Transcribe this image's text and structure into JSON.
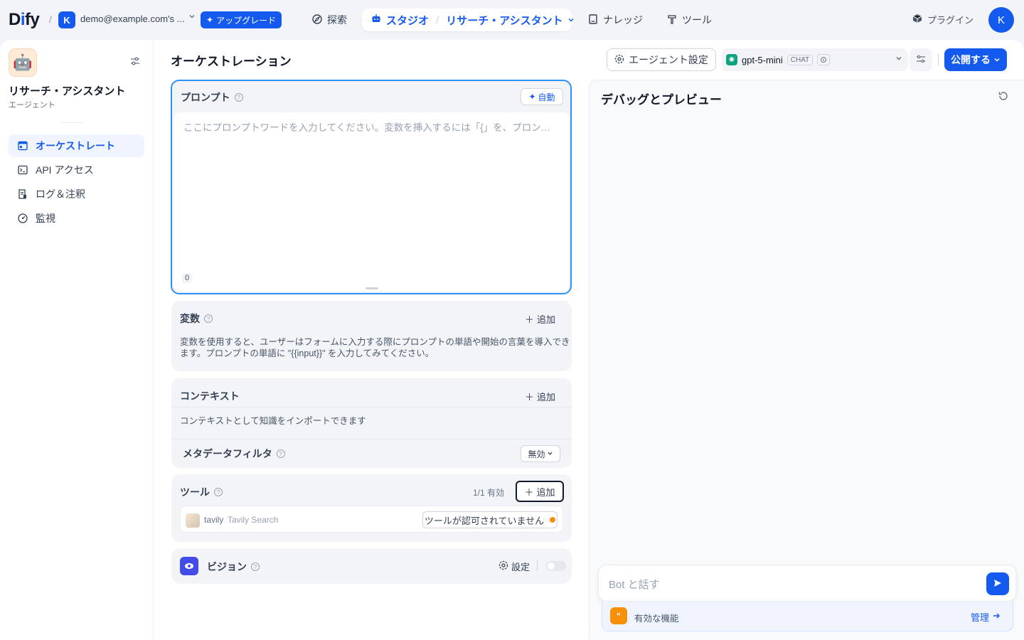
{
  "topbar": {
    "logo": {
      "prefix": "D",
      "accent": "i",
      "suffix": "fy"
    },
    "workspace": {
      "initial": "K",
      "name": "demo@example.com's ..."
    },
    "upgrade_label": "アップグレード",
    "nav": {
      "explore": "探索",
      "studio": "スタジオ",
      "app_breadcrumb": "リサーチ・アシスタント",
      "knowledge": "ナレッジ",
      "tools": "ツール"
    },
    "plugin_label": "プラグイン",
    "user_initial": "K"
  },
  "sidebar": {
    "app_name": "リサーチ・アシスタント",
    "app_type": "エージェント",
    "items": [
      {
        "label": "オーケストレート",
        "icon": "layout-icon",
        "active": true
      },
      {
        "label": "API アクセス",
        "icon": "terminal-icon",
        "active": false
      },
      {
        "label": "ログ＆注釈",
        "icon": "file-list-icon",
        "active": false
      },
      {
        "label": "監視",
        "icon": "gauge-icon",
        "active": false
      }
    ]
  },
  "main": {
    "title": "オーケストレーション",
    "agent_settings_label": "エージェント設定",
    "model": {
      "name": "gpt-5-mini",
      "mode_tag": "CHAT"
    },
    "publish_label": "公開する",
    "prompt": {
      "title": "プロンプト",
      "auto_label": "自動",
      "placeholder": "ここにプロンプトワードを入力してください。変数を挿入するには「{」を、プロンプトコンテンツブロックを挿入するには「/」を入力します。",
      "char_count": "0"
    },
    "variables": {
      "title": "変数",
      "add_label": "追加",
      "description_line1": "変数を使用すると、ユーザーはフォームに入力する際にプロンプトの単語や開始の言葉を導入でき",
      "description_line2": "ます。プロンプトの単語に \"{{input}}\" を入力してみてください。"
    },
    "context": {
      "title": "コンテキスト",
      "add_label": "追加",
      "description": "コンテキストとして知識をインポートできます",
      "metadata_filter_label": "メタデータフィルタ",
      "metadata_filter_value": "無効"
    },
    "tools": {
      "title": "ツール",
      "count_label": "1/1 有効",
      "add_label": "追加",
      "items": [
        {
          "provider": "tavily",
          "name": "Tavily Search",
          "status": "ツールが認可されていません"
        }
      ]
    },
    "vision": {
      "title": "ビジョン",
      "settings_label": "設定",
      "enabled": false
    }
  },
  "debug": {
    "title": "デバッグとプレビュー",
    "input_placeholder": "Bot と話す",
    "features_label": "有効な機能",
    "manage_label": "管理"
  },
  "colors": {
    "accent": "#155aef",
    "warning": "#f79009",
    "vision": "#444ce7"
  }
}
